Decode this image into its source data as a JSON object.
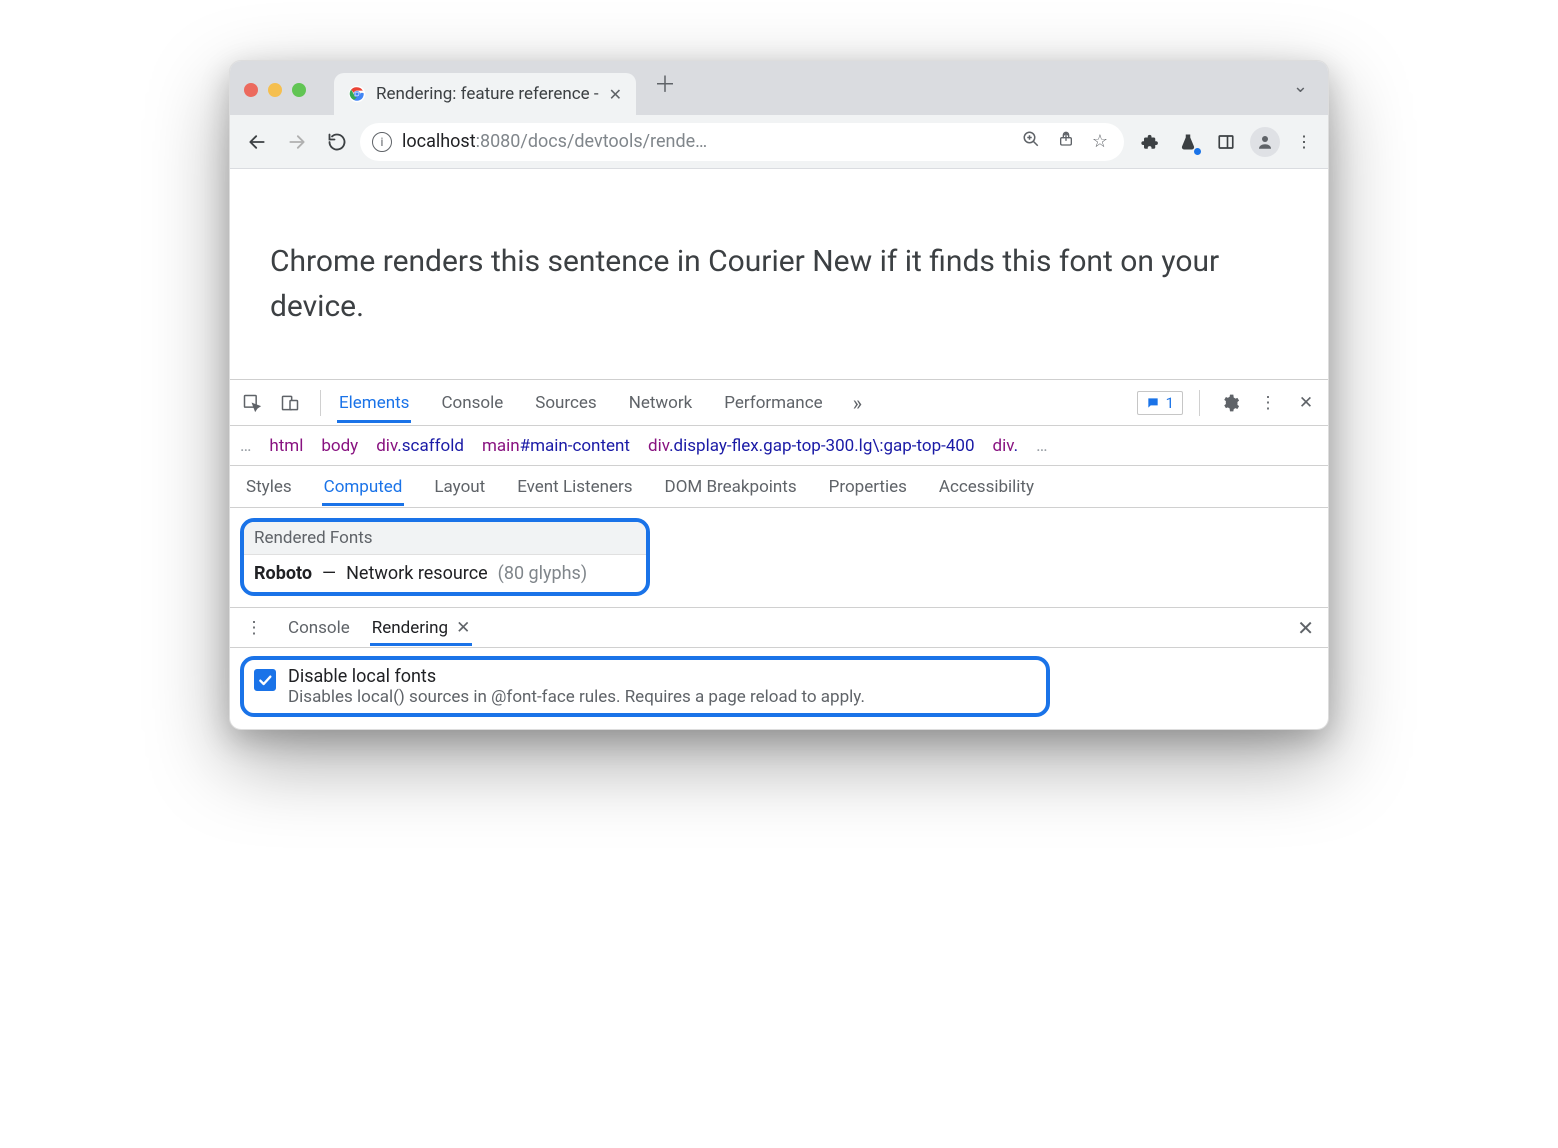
{
  "tab": {
    "title": "Rendering: feature reference -"
  },
  "url": {
    "host": "localhost",
    "port_path": ":8080/docs/devtools/rende…"
  },
  "page": {
    "text": "Chrome renders this sentence in Courier New if it finds this font on your device."
  },
  "devtools": {
    "tabs": [
      "Elements",
      "Console",
      "Sources",
      "Network",
      "Performance"
    ],
    "activeTab": "Elements",
    "issues_count": "1",
    "breadcrumbs": [
      {
        "tag": "html"
      },
      {
        "tag": "body"
      },
      {
        "tag": "div",
        "cls": ".scaffold"
      },
      {
        "tag": "main",
        "id": "#main-content"
      },
      {
        "tag": "div",
        "cls": ".display-flex.gap-top-300.lg\\:gap-top-400"
      },
      {
        "tag": "div",
        "cls": "."
      }
    ],
    "subtabs": [
      "Styles",
      "Computed",
      "Layout",
      "Event Listeners",
      "DOM Breakpoints",
      "Properties",
      "Accessibility"
    ],
    "activeSubtab": "Computed",
    "rendered_fonts": {
      "heading": "Rendered Fonts",
      "font": "Roboto",
      "dash": "—",
      "source": "Network resource",
      "glyphs": "(80 glyphs)"
    },
    "drawer": {
      "tabs": [
        "Console",
        "Rendering"
      ],
      "activeTab": "Rendering",
      "option": {
        "title": "Disable local fonts",
        "desc": "Disables local() sources in @font-face rules. Requires a page reload to apply."
      }
    }
  }
}
